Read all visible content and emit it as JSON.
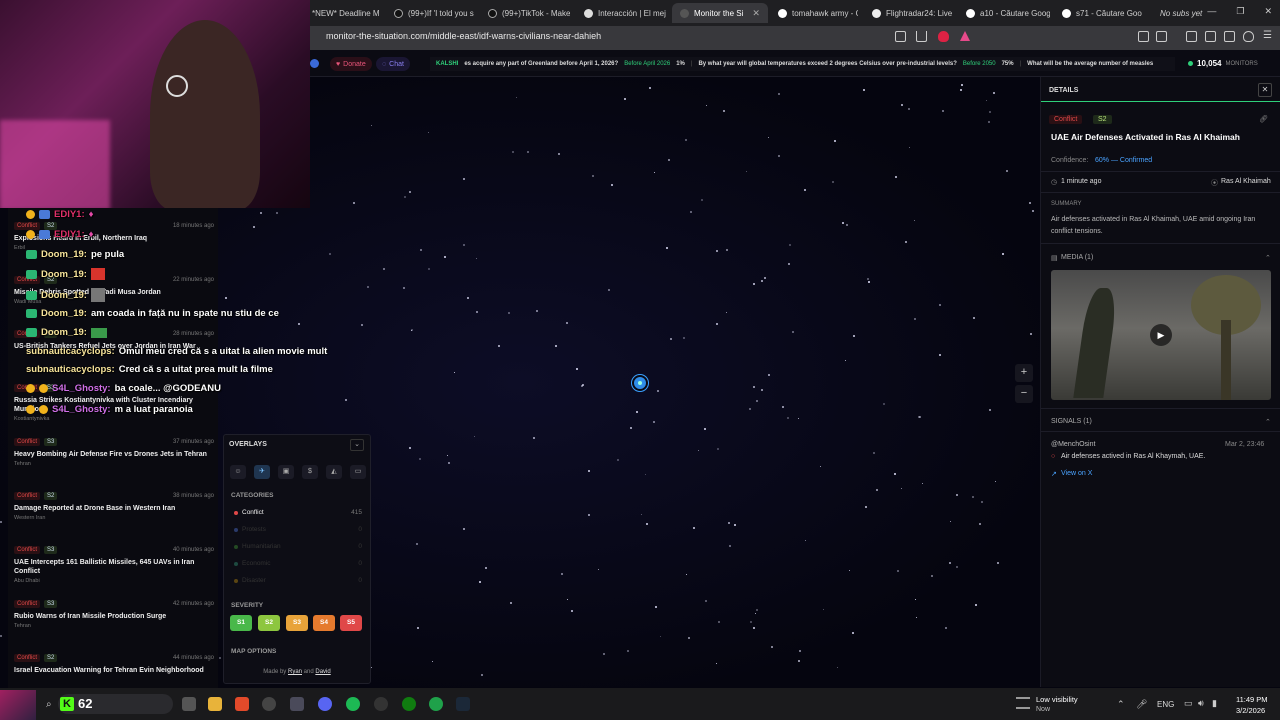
{
  "browser": {
    "tabs": [
      {
        "label": "*NEW* Deadline M"
      },
      {
        "label": "(99+)If 'I told you s"
      },
      {
        "label": "(99+)TikTok - Make"
      },
      {
        "label": "Interacción | El mej"
      },
      {
        "label": "Monitor the Si",
        "active": true
      },
      {
        "label": "tomahawk army - G"
      },
      {
        "label": "Flightradar24: Live"
      },
      {
        "label": "a10 - Căutare Goog"
      },
      {
        "label": "s71 - Căutare Goo"
      },
      {
        "label": "No subs yet"
      }
    ],
    "url": "monitor-the-situation.com/middle-east/idf-warns-civilians-near-dahieh"
  },
  "header": {
    "donate": "Donate",
    "chat": "Chat",
    "ticker": {
      "brand": "KALSHI",
      "items": [
        {
          "q": "es acquire any part of Greenland before April 1, 2026?",
          "answer": "Before April 2026",
          "pct": "1%"
        },
        {
          "q": "By what year will global temperatures exceed 2 degrees Celsius over pre-industrial levels?",
          "answer": "Before 2050",
          "pct": "75%"
        },
        {
          "q": "What will be the average number of measles",
          "answer": "",
          "pct": ""
        }
      ]
    },
    "monitors_count": "10,054",
    "monitors_label": "MONITORS"
  },
  "events": [
    {
      "cat": "Conflict",
      "sev": "S2",
      "time": "18 minutes ago",
      "title": "Explosions Heard in Erbil, Northern Iraq",
      "loc": "Erbil"
    },
    {
      "cat": "Conflict",
      "sev": "S2",
      "time": "22 minutes ago",
      "title": "Missile Debris Spotted in Wadi Musa Jordan",
      "loc": "Wadi Musa"
    },
    {
      "cat": "Conflict",
      "sev": "S2",
      "time": "28 minutes ago",
      "title": "US-British Tankers Refuel Jets over Jordan in Iran War",
      "loc": ""
    },
    {
      "cat": "Conflict",
      "sev": "S3",
      "time": "",
      "title": "Russia Strikes Kostiantynivka with Cluster Incendiary Munitions",
      "loc": "Kostiantynivka"
    },
    {
      "cat": "Conflict",
      "sev": "S3",
      "time": "37 minutes ago",
      "title": "Heavy Bombing Air Defense Fire vs Drones Jets in Tehran",
      "loc": "Tehran"
    },
    {
      "cat": "Conflict",
      "sev": "S2",
      "time": "38 minutes ago",
      "title": "Damage Reported at Drone Base in Western Iran",
      "loc": "Western Iran"
    },
    {
      "cat": "Conflict",
      "sev": "S3",
      "time": "40 minutes ago",
      "title": "UAE Intercepts 161 Ballistic Missiles, 645 UAVs in Iran Conflict",
      "loc": "Abu Dhabi"
    },
    {
      "cat": "Conflict",
      "sev": "S3",
      "time": "42 minutes ago",
      "title": "Rubio Warns of Iran Missile Production Surge",
      "loc": "Tehran"
    },
    {
      "cat": "Conflict",
      "sev": "S2",
      "time": "44 minutes ago",
      "title": "Israel Evacuation Warning for Tehran Evin Neighborhood",
      "loc": ""
    }
  ],
  "chat": [
    {
      "user": "EDIY1:",
      "msg": ""
    },
    {
      "user": "EDIY1:",
      "msg": ""
    },
    {
      "user": "Doom_19:",
      "msg": "pe pula"
    },
    {
      "user": "Doom_19:",
      "msg": ""
    },
    {
      "user": "Doom_19:",
      "msg": ""
    },
    {
      "user": "Doom_19:",
      "msg": "am coada in față nu in spate nu stiu de ce"
    },
    {
      "user": "Doom_19:",
      "msg": ""
    },
    {
      "user": "subnauticacyclops:",
      "msg": "Omul meu cred că s a uitat la alien movie mult"
    },
    {
      "user": "subnauticacyclops:",
      "msg": "Cred că s a uitat prea mult la filme"
    },
    {
      "user": "S4L_Ghosty:",
      "msg": "ba coale... @GODEANU"
    },
    {
      "user": "S4L_Ghosty:",
      "msg": "m a luat paranoia"
    }
  ],
  "overlays": {
    "title": "OVERLAYS",
    "categories_label": "CATEGORIES",
    "categories": [
      {
        "name": "Conflict",
        "count": "415",
        "color": "#e04848"
      },
      {
        "name": "Protests",
        "count": "0",
        "color": "#3a5a9a"
      },
      {
        "name": "Humanitarian",
        "count": "0",
        "color": "#3a7a3a"
      },
      {
        "name": "Economic",
        "count": "0",
        "color": "#2a6a5a"
      },
      {
        "name": "Disaster",
        "count": "0",
        "color": "#8a6a1a"
      }
    ],
    "severity_label": "SEVERITY",
    "severity": [
      {
        "label": "S1",
        "color": "#49b84a"
      },
      {
        "label": "S2",
        "color": "#8dc63f"
      },
      {
        "label": "S3",
        "color": "#e8a33a"
      },
      {
        "label": "S4",
        "color": "#e57a2e"
      },
      {
        "label": "S5",
        "color": "#e04848"
      }
    ],
    "map_options": "MAP OPTIONS",
    "made_by": "Made by",
    "author1": "Ryan",
    "and": "and",
    "author2": "David"
  },
  "details": {
    "header": "DETAILS",
    "cat": "Conflict",
    "sev": "S2",
    "title": "UAE Air Defenses Activated in Ras Al Khaimah",
    "confidence_label": "Confidence:",
    "confidence_value": "60% — Confirmed",
    "time": "1 minute ago",
    "location": "Ras Al Khaimah",
    "summary_label": "SUMMARY",
    "summary": "Air defenses activated in Ras Al Khaimah, UAE amid ongoing Iran conflict tensions.",
    "media_label": "MEDIA (1)",
    "signals_label": "SIGNALS (1)",
    "signal_author": "@MenchOsint",
    "signal_date": "Mar 2, 23:46",
    "signal_text": "Air defenses actived in Ras Al Khaymah, UAE.",
    "signal_link": "View on X"
  },
  "taskbar": {
    "counter": "62",
    "weather": "Low visibility",
    "weather_sub": "Now",
    "lang": "ENG",
    "time": "11:49 PM",
    "date": "3/2/2026"
  }
}
